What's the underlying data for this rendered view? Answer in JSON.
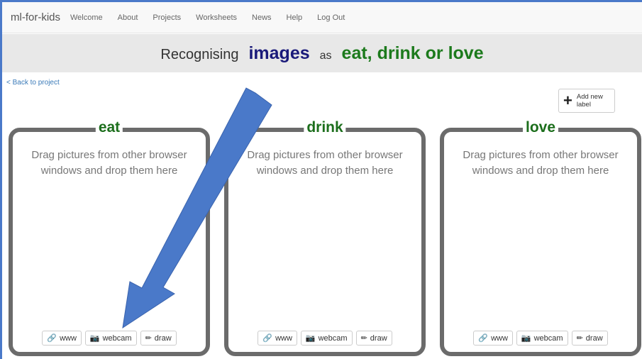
{
  "navbar": {
    "brand": "ml-for-kids",
    "links": [
      "Welcome",
      "About",
      "Projects",
      "Worksheets",
      "News",
      "Help",
      "Log Out"
    ]
  },
  "banner": {
    "prefix": "Recognising",
    "type": "images",
    "as": "as",
    "labels": "eat, drink or love"
  },
  "back_link": "< Back to project",
  "add_label_button": "Add new label",
  "buckets": [
    {
      "label": "eat",
      "drop_text": "Drag pictures from other browser windows and drop them here"
    },
    {
      "label": "drink",
      "drop_text": "Drag pictures from other browser windows and drop them here"
    },
    {
      "label": "love",
      "drop_text": "Drag pictures from other browser windows and drop them here"
    }
  ],
  "bucket_buttons": {
    "www": "www",
    "webcam": "webcam",
    "draw": "draw"
  },
  "colors": {
    "arrow": "#4a79c9",
    "label_green": "#1c6e1c",
    "type_blue": "#1a1a7a",
    "bucket_border": "#6b6b6b"
  },
  "icons": {
    "www": "link-icon",
    "webcam": "camera-icon",
    "draw": "pencil-icon",
    "add": "plus-icon",
    "annotation": "arrow-icon"
  }
}
